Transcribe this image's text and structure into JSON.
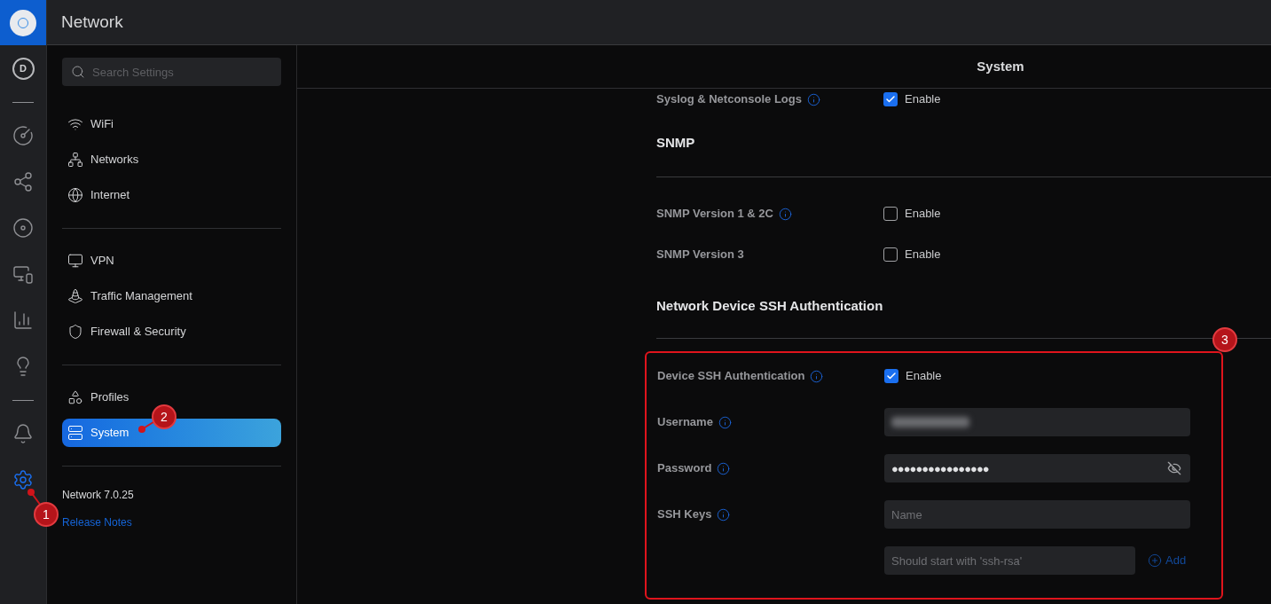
{
  "app_title": "Network",
  "rail": [
    {
      "kind": "avatar",
      "label": "D",
      "selected": false
    },
    {
      "kind": "divider"
    },
    {
      "kind": "gauge",
      "selected": false
    },
    {
      "kind": "topology",
      "selected": false
    },
    {
      "kind": "disc",
      "selected": false
    },
    {
      "kind": "devices",
      "selected": false
    },
    {
      "kind": "stats",
      "selected": false
    },
    {
      "kind": "bulb",
      "selected": false
    },
    {
      "kind": "divider"
    },
    {
      "kind": "bell",
      "selected": false
    },
    {
      "kind": "gear",
      "selected": true
    }
  ],
  "sidebar": {
    "search": {
      "placeholder": "Search Settings"
    },
    "groups": [
      [
        {
          "label": "WiFi",
          "kind": "wifi",
          "selected": false
        },
        {
          "label": "Networks",
          "kind": "network",
          "selected": false
        },
        {
          "label": "Internet",
          "kind": "globe",
          "selected": false
        }
      ],
      [
        {
          "label": "VPN",
          "kind": "vpn",
          "selected": false
        },
        {
          "label": "Traffic Management",
          "kind": "traffic",
          "selected": false
        },
        {
          "label": "Firewall & Security",
          "kind": "shield",
          "selected": false
        }
      ],
      [
        {
          "label": "Profiles",
          "kind": "shapes",
          "selected": false
        },
        {
          "label": "System",
          "kind": "system",
          "selected": true
        }
      ]
    ],
    "version": "Network 7.0.25",
    "release_notes": "Release Notes"
  },
  "main": {
    "title": "System",
    "sections": [
      {
        "rows": [
          {
            "kind": "checkbox",
            "label": "Syslog & Netconsole Logs",
            "info": true,
            "checked": true,
            "option": "Enable"
          }
        ]
      },
      {
        "heading": "SNMP",
        "rows": [
          {
            "kind": "checkbox",
            "label": "SNMP Version 1 & 2C",
            "info": true,
            "checked": false,
            "option": "Enable"
          },
          {
            "kind": "checkbox",
            "label": "SNMP Version 3",
            "info": false,
            "checked": false,
            "option": "Enable"
          }
        ]
      },
      {
        "heading": "Network Device SSH Authentication",
        "highlighted": true,
        "rows": [
          {
            "kind": "checkbox",
            "label": "Device SSH Authentication",
            "info": true,
            "checked": true,
            "option": "Enable"
          },
          {
            "kind": "redacted",
            "label": "Username",
            "info": true
          },
          {
            "kind": "password",
            "label": "Password",
            "info": true,
            "value": "●●●●●●●●●●●●●●●●"
          },
          {
            "kind": "text",
            "label": "SSH Keys",
            "info": true,
            "placeholder": "Name"
          },
          {
            "kind": "add",
            "placeholder": "Should start with 'ssh-rsa'",
            "button": "Add"
          }
        ]
      }
    ]
  },
  "annotations": [
    {
      "label": "1"
    },
    {
      "label": "2"
    },
    {
      "label": "3"
    }
  ]
}
